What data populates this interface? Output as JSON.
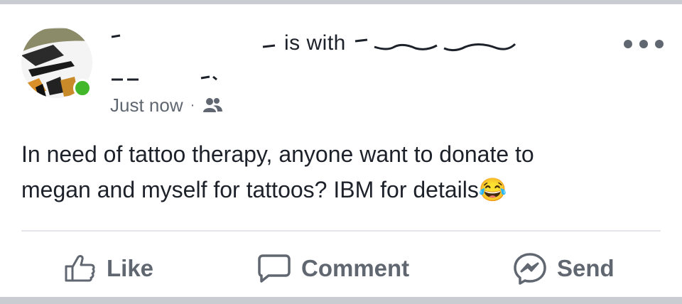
{
  "post": {
    "header_text": "is with",
    "timestamp": "Just now",
    "separator": "·",
    "audience_icon": "friends-icon",
    "body_line1": "In need of tattoo therapy, anyone want to donate to",
    "body_line2": "megan and myself for tattoos? IBM for details",
    "emoji": "😂"
  },
  "actions": {
    "like_label": "Like",
    "comment_label": "Comment",
    "send_label": "Send"
  },
  "colors": {
    "online": "#42b72a",
    "text": "#1d2129",
    "muted": "#606770"
  }
}
